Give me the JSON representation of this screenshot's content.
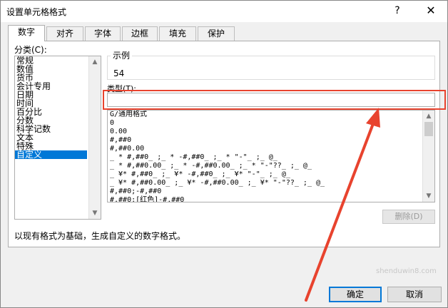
{
  "dialog": {
    "title": "设置单元格格式",
    "help_label": "?",
    "close_label": "✕"
  },
  "tabs": [
    {
      "label": "数字",
      "active": true
    },
    {
      "label": "对齐"
    },
    {
      "label": "字体"
    },
    {
      "label": "边框"
    },
    {
      "label": "填充"
    },
    {
      "label": "保护"
    }
  ],
  "category": {
    "label": "分类(C):",
    "items": [
      "常规",
      "数值",
      "货币",
      "会计专用",
      "日期",
      "时间",
      "百分比",
      "分数",
      "科学记数",
      "文本",
      "特殊",
      "自定义"
    ],
    "selected": "自定义"
  },
  "sample": {
    "label": "示例",
    "value": "54"
  },
  "type": {
    "label": "类型(T):",
    "value": ""
  },
  "formats": [
    "G/通用格式",
    "0",
    "0.00",
    "#,##0",
    "#,##0.00",
    "_ * #,##0_ ;_ * -#,##0_ ;_ * \"-\"_ ;_ @_",
    "_ * #,##0.00_ ;_ * -#,##0.00_ ;_ * \"-\"??_ ;_ @_",
    "_ ¥* #,##0_ ;_ ¥* -#,##0_ ;_ ¥* \"-\"_ ;_ @_",
    "_ ¥* #,##0.00_ ;_ ¥* -#,##0.00_ ;_ ¥* \"-\"??_ ;_ @_",
    "#,##0;-#,##0",
    "#,##0;[红色]-#,##0"
  ],
  "buttons": {
    "delete": "删除(D)",
    "ok": "确定",
    "cancel": "取消"
  },
  "description": "以现有格式为基础，生成自定义的数字格式。",
  "watermark": "shenduwin8.com",
  "colors": {
    "accent": "#0078d7",
    "annotation": "#e8432e"
  }
}
